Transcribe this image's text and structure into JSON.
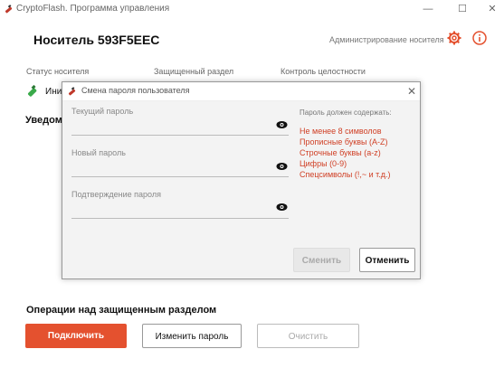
{
  "window": {
    "title": "CryptoFlash. Программа управления",
    "minimize": "—",
    "maximize": "☐",
    "close": "✕"
  },
  "header": {
    "title_prefix": "Носитель",
    "device_id": "593F5EEC",
    "admin_link": "Администрирование носителя"
  },
  "info_labels": {
    "status": "Статус носителя",
    "protected": "Защищенный раздел",
    "integrity": "Контроль целостности"
  },
  "status_value": "Ини",
  "notifications_title": "Уведом",
  "operations": {
    "title": "Операции над защищенным разделом",
    "connect_label": "Подключить",
    "change_password_label": "Изменить пароль",
    "check_label": "Очистить"
  },
  "dialog": {
    "title": "Смена пароля пользователя",
    "close": "✕",
    "fields": [
      {
        "label": "Текущий пароль",
        "value": ""
      },
      {
        "label": "Новый пароль",
        "value": ""
      },
      {
        "label": "Подтверждение пароля",
        "value": ""
      }
    ],
    "requirements_title": "Пароль должен содержать:",
    "requirements": [
      "Не менее 8 символов",
      "Прописные буквы (A-Z)",
      "Строчные буквы (a-z)",
      "Цифры (0-9)",
      "Спецсимволы (!,~ и т.д.)"
    ],
    "change_label": "Сменить",
    "cancel_label": "Отменить"
  },
  "colors": {
    "accent": "#e4512f",
    "requirement_text": "#d04026"
  }
}
